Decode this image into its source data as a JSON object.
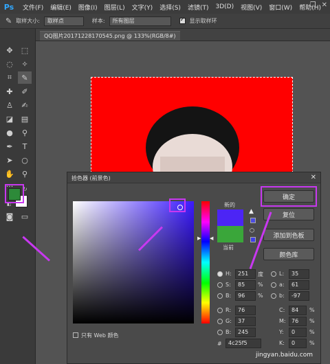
{
  "app": {
    "logo": "Ps"
  },
  "menu": [
    "文件(F)",
    "编辑(E)",
    "图像(I)",
    "图层(L)",
    "文字(Y)",
    "选择(S)",
    "滤镜(T)",
    "3D(D)",
    "视图(V)",
    "窗口(W)",
    "帮助(H)"
  ],
  "options_bar": {
    "sample_size_label": "取样大小:",
    "sample_size_value": "取样点",
    "sample_label": "样本:",
    "sample_value": "所有图层",
    "show_ring_label": "显示取样环"
  },
  "document": {
    "tab": "QQ图片20171228170545.png @ 133%(RGB/8#)"
  },
  "dialog": {
    "title": "拾色器 (前景色)",
    "new_label": "新的",
    "current_label": "当前",
    "new_color": "#4c25f5",
    "current_color": "#3aa63a",
    "buttons": {
      "ok": "确定",
      "reset": "复位",
      "add_swatch": "添加到色板",
      "libraries": "颜色库"
    },
    "fields": {
      "H": "251",
      "H_unit": "度",
      "S": "85",
      "S_unit": "%",
      "B": "96",
      "B_unit": "%",
      "R": "76",
      "G": "37",
      "Bv": "245",
      "L": "35",
      "a": "61",
      "b": "-97",
      "C": "84",
      "M": "76",
      "Y": "0",
      "K": "0",
      "pct": "%",
      "hex": "4c25f5"
    },
    "web_only_label": "只有 Web 颜色"
  },
  "watermark": "jingyan.baidu.com",
  "colors": {
    "annotation": "#c838f0",
    "foreground": "#2d8a39",
    "canvas_bg": "#ff0000"
  }
}
